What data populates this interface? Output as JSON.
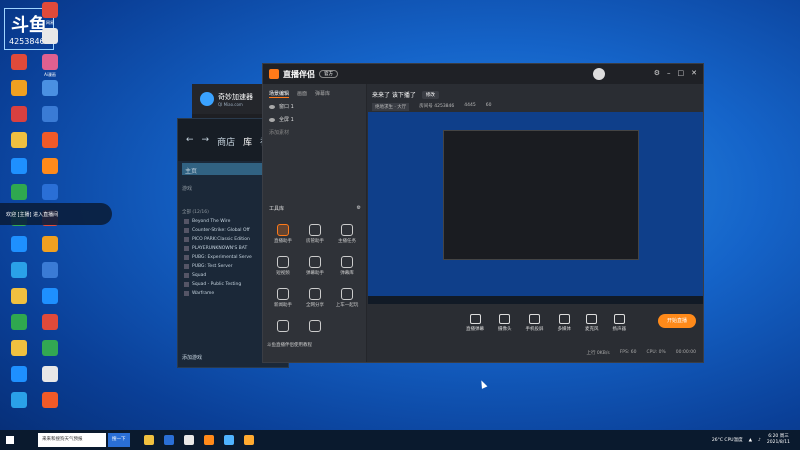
{
  "desktop": {
    "logo_text": "斗鱼",
    "logo_number": "4253846",
    "icons": [
      {
        "label": "",
        "color": "#f0c040"
      },
      {
        "label": "网易",
        "color": "#e04a3a"
      },
      {
        "label": "",
        "color": "#2aa1e8"
      },
      {
        "label": "",
        "color": "#e8e8e8"
      },
      {
        "label": "",
        "color": "#e04a3a"
      },
      {
        "label": "Ai漫画",
        "color": "#e06090"
      },
      {
        "label": "",
        "color": "#f0a020"
      },
      {
        "label": "",
        "color": "#4a90e2"
      },
      {
        "label": "",
        "color": "#d84040"
      },
      {
        "label": "",
        "color": "#3a7bd5"
      },
      {
        "label": "",
        "color": "#f0c040"
      },
      {
        "label": "",
        "color": "#f05a28"
      },
      {
        "label": "",
        "color": "#1e90ff"
      },
      {
        "label": "",
        "color": "#ff8a1a"
      },
      {
        "label": "",
        "color": "#2fa84f"
      },
      {
        "label": "",
        "color": "#2a6fd6"
      },
      {
        "label": "",
        "color": "#32a852"
      },
      {
        "label": "",
        "color": "#e04a3a"
      },
      {
        "label": "",
        "color": "#1e90ff"
      },
      {
        "label": "",
        "color": "#f0a020"
      },
      {
        "label": "",
        "color": "#2aa1e8"
      },
      {
        "label": "",
        "color": "#3a7bd5"
      },
      {
        "label": "",
        "color": "#f0c040"
      },
      {
        "label": "",
        "color": "#1e90ff"
      },
      {
        "label": "",
        "color": "#2fa84f"
      },
      {
        "label": "",
        "color": "#e04a3a"
      },
      {
        "label": "",
        "color": "#f0c040"
      },
      {
        "label": "",
        "color": "#32a852"
      },
      {
        "label": "",
        "color": "#1e90ff"
      },
      {
        "label": "",
        "color": "#e8e8e8"
      },
      {
        "label": "",
        "color": "#2aa1e8"
      },
      {
        "label": "",
        "color": "#f05a28"
      }
    ],
    "notification": "欢迎 [主播] 进入直播间"
  },
  "accelerator": {
    "title": "奇妙加速器",
    "subtitle": "QI Miao.com"
  },
  "steam": {
    "nav": [
      "←",
      "→",
      "商店",
      "库",
      "社"
    ],
    "search": "主页",
    "filter": "游戏",
    "category": "全部 (12/16)",
    "games": [
      "Beyond The Wire",
      "Counter-Strike: Global Off",
      "PICO PARK:Classic Edition",
      "PLAYERUNKNOWN'S BAT",
      "PUBG: Experimental Serve",
      "PUBG: Test Server",
      "Squad",
      "Squad - Public Testing",
      "Warframe"
    ],
    "add_game": "添加游戏"
  },
  "live": {
    "app_name": "直播伴侣",
    "version_badge": "官方",
    "title": "来来了 该下播了",
    "title_tag": "修改",
    "category": "绝地求生 · 大厅",
    "room": "房间号 4253846",
    "fans": "4445",
    "online": "60",
    "tabs": [
      "场景编辑",
      "画面",
      "弹幕库"
    ],
    "scenes": [
      "窗口 1",
      "全屏 1"
    ],
    "add_source": "添加素材",
    "tools_title": "工具库",
    "tools": [
      {
        "label": "直播助手",
        "hot": true
      },
      {
        "label": "房管助手",
        "hot": false
      },
      {
        "label": "主播任务",
        "hot": false
      },
      {
        "label": "短视频",
        "hot": false
      },
      {
        "label": "弹幕助手",
        "hot": false
      },
      {
        "label": "弹幕库",
        "hot": false
      },
      {
        "label": "新闻助手",
        "hot": false
      },
      {
        "label": "全网分享",
        "hot": false
      },
      {
        "label": "上车一起玩",
        "hot": false
      },
      {
        "label": "",
        "hot": false
      },
      {
        "label": "",
        "hot": false
      }
    ],
    "footer_notice": "斗鱼直播伴侣使用教程",
    "controls": [
      {
        "label": "直播弹幕"
      },
      {
        "label": "摄像头"
      },
      {
        "label": "手机投屏"
      },
      {
        "label": "多媒体"
      },
      {
        "label": "麦克风"
      },
      {
        "label": "扬声器"
      }
    ],
    "go_live": "开始直播",
    "status": [
      "上行 0KB/s",
      "FPS: 60",
      "CPU: 0%",
      "00:00:00"
    ]
  },
  "taskbar": {
    "search_placeholder": "来来和搜狗天气预报",
    "search_button": "搜一下",
    "apps": [
      {
        "color": "#f0c040"
      },
      {
        "color": "#2a6fd6"
      },
      {
        "color": "#e8e8e8"
      },
      {
        "color": "#ff8a1a"
      },
      {
        "color": "#4fb3ff"
      },
      {
        "color": "#ffaa30"
      }
    ],
    "weather": "26°C CPU温度",
    "time": "6:20 周三",
    "date": "2021/8/11"
  }
}
